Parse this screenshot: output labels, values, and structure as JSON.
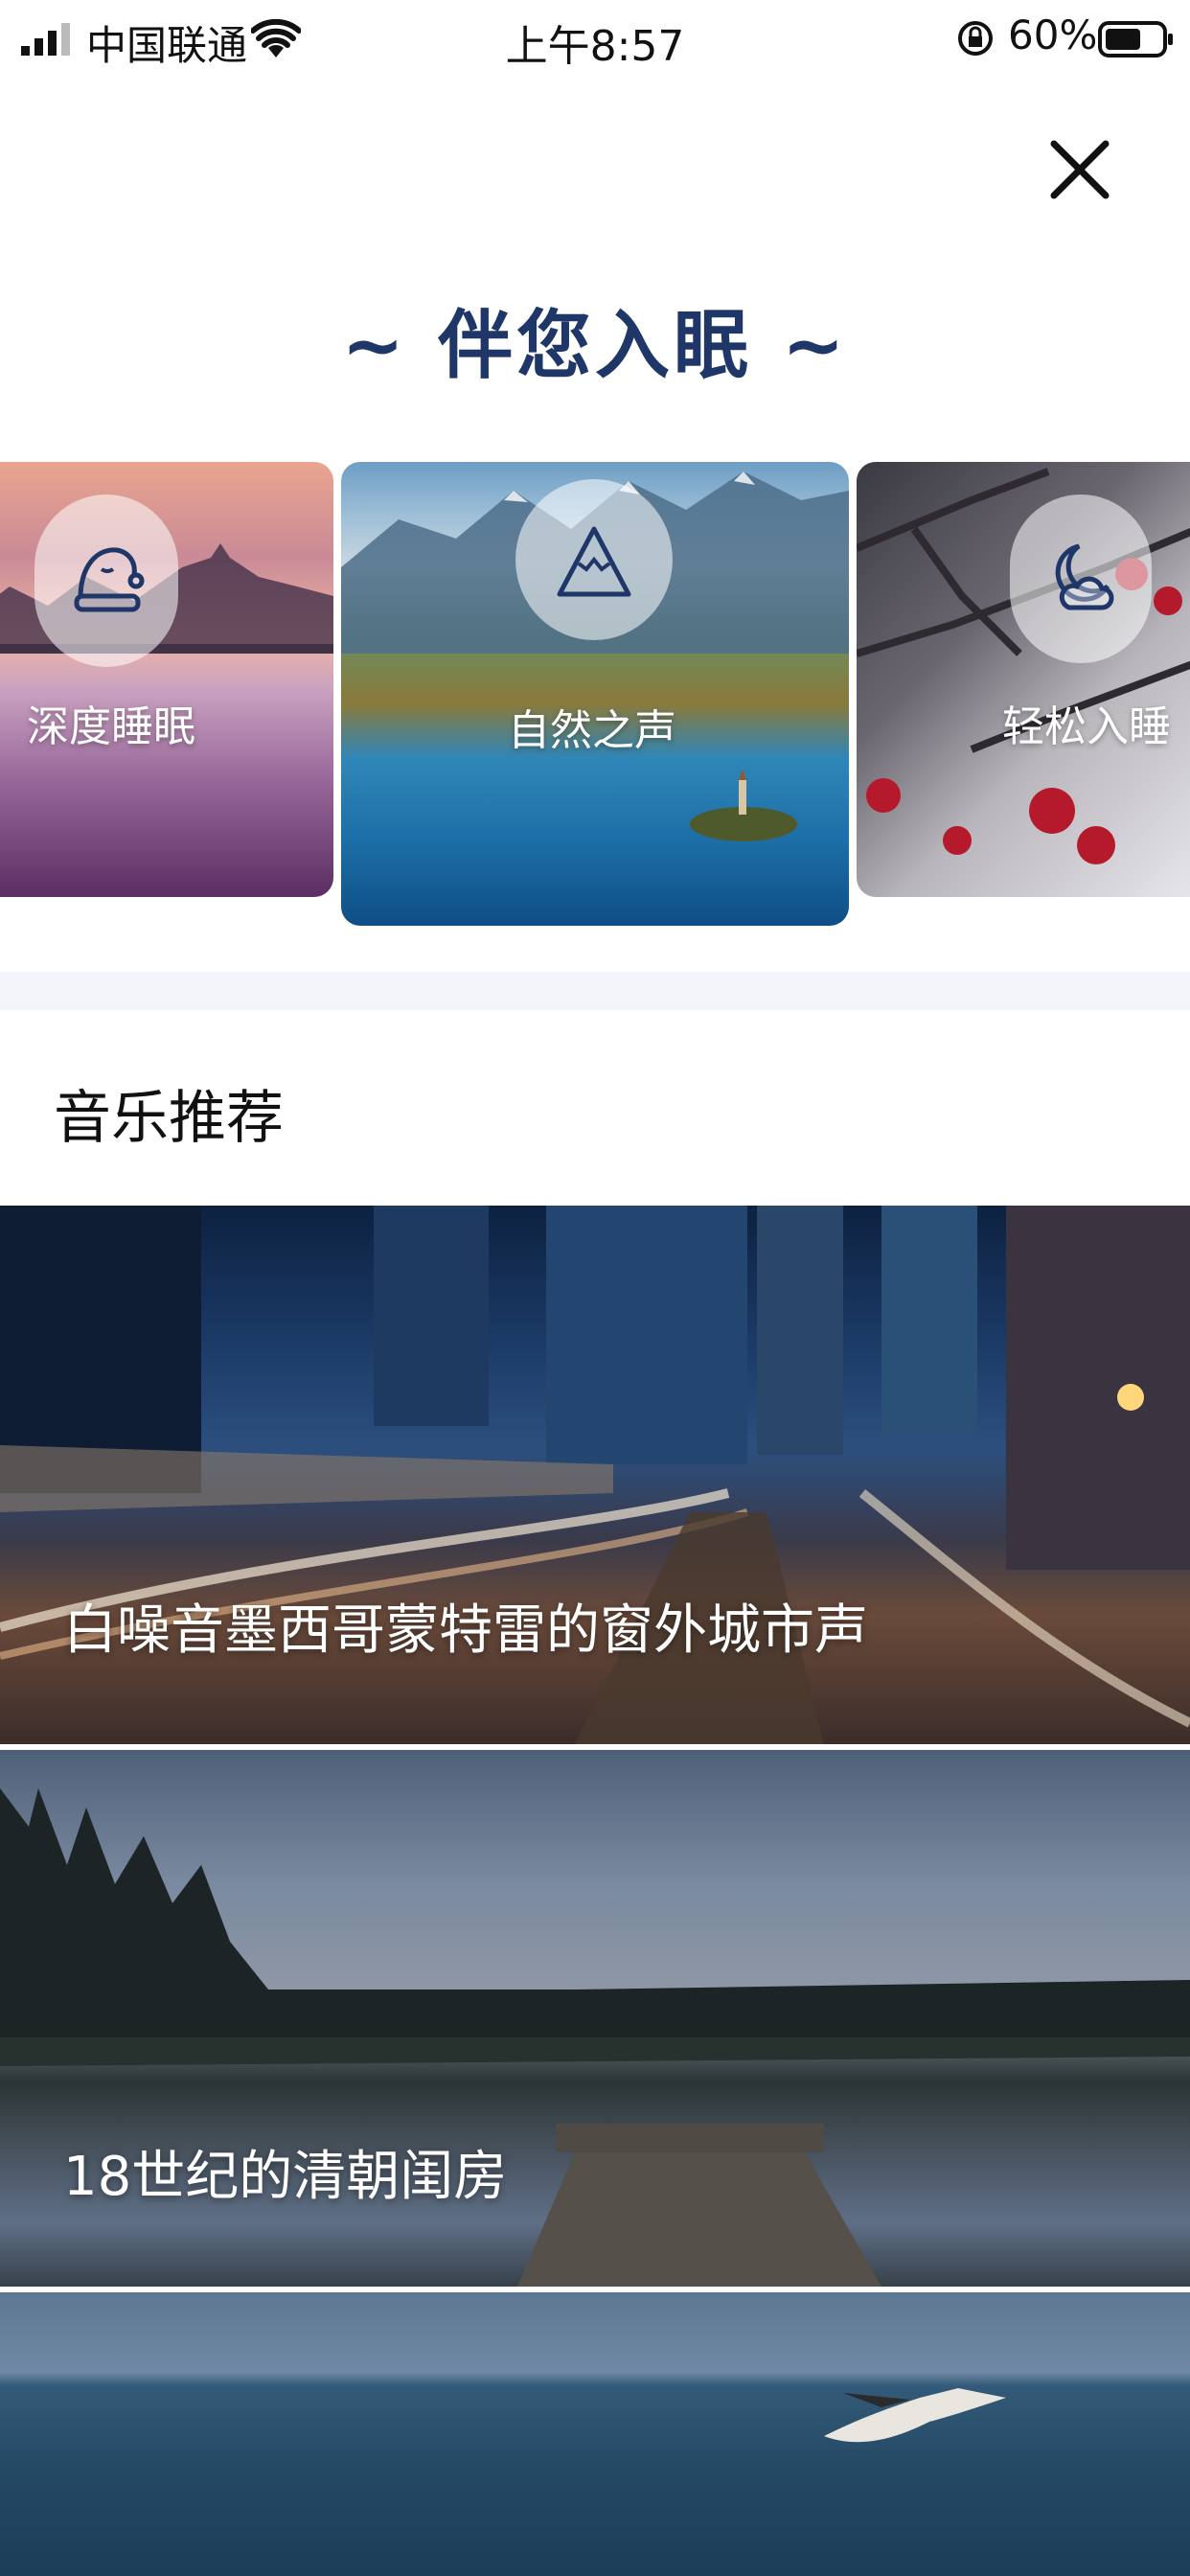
{
  "status_bar": {
    "carrier": "中国联通",
    "time": "上午8:57",
    "battery_percent": "60%"
  },
  "header": {
    "title": "~ 伴您入眠 ~",
    "close_icon": "close-icon"
  },
  "categories": [
    {
      "label": "深度睡眠",
      "icon": "sleep-cap-icon"
    },
    {
      "label": "自然之声",
      "icon": "mountain-icon"
    },
    {
      "label": "轻松入睡",
      "icon": "moon-cloud-icon"
    }
  ],
  "music_section": {
    "title": "音乐推荐",
    "items": [
      {
        "title": "白噪音墨西哥蒙特雷的窗外城市声"
      },
      {
        "title": "18世纪的清朝闺房"
      },
      {
        "title": ""
      }
    ]
  },
  "colors": {
    "title": "#1f3768",
    "divider": "#f4f5fa"
  }
}
